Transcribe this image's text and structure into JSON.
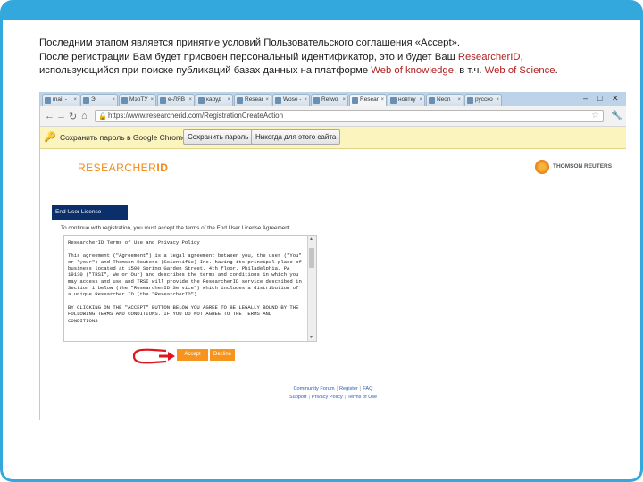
{
  "caption": {
    "line1": "Последним этапом является принятие условий Пользовательского соглашения «Accept».",
    "line2": "После регистрации Вам будет присвоен персональный идентификатор, это и будет Ваш",
    "line2_hl": "ResearcherID,",
    "line3": "использующийся при поиске публикаций базах данных на платформе",
    "line3_hl1": "Web of knowledge",
    "line3_mid": ", в т.ч.",
    "line3_hl2": "Web of Science",
    "line3_end": "."
  },
  "browser": {
    "tabs": [
      "mail -",
      "Э",
      "МэрТУ",
      "e-ЛЯВ",
      "каруд",
      "Resear",
      "Wose -",
      "Refwo",
      "Resear",
      "новтку",
      "Neon",
      "русско"
    ],
    "url": "https://www.researcherid.com/RegistrationCreateAction",
    "infobar": {
      "message": "Сохранить пароль в Google Chrome?",
      "save": "Сохранить пароль",
      "never": "Никогда для этого сайта"
    }
  },
  "page": {
    "logo_regular": "RESEARCHER",
    "logo_bold": "ID",
    "partner_logo": "THOMSON REUTERS",
    "eula_tab": "End User License",
    "intro": "To continue with registration, you must accept the terms of the End User License Agreement.",
    "terms_title": "ResearcherID Terms of Use and Privacy Policy",
    "terms_p1": "This agreement (\"Agreement\") is a legal agreement between you, the user (\"You\" or \"your\") and Thomson Reuters (Scientific) Inc. having its principal place of business located at 1500 Spring Garden Street, 4th floor, Philadelphia, PA 19130 (\"TRSI\", We or Our) and describes the terms and conditions in which you may access and use and TRSI will provide the ResearcherID service described in Section 1 below (the \"ResearcherID Service\") which includes a distribution of a unique Researcher ID (the \"ResearcherID\").",
    "terms_p2": "BY CLICKING ON THE \"ACCEPT\" BUTTON BELOW YOU AGREE TO BE LEGALLY BOUND BY THE FOLLOWING TERMS AND CONDITIONS. IF YOU DO NOT AGREE TO THE TERMS AND CONDITIONS",
    "accept": "Accept",
    "decline": "Decline",
    "footer_row1": [
      "Community Forum",
      "Register",
      "FAQ"
    ],
    "footer_row2": [
      "Support",
      "Privacy Policy",
      "Terms of Use"
    ]
  },
  "colors": {
    "frame": "#33a8dc",
    "highlight": "#b01e1e",
    "brand_orange": "#f7941d",
    "eula_navy": "#0b2f6b",
    "arrow_red": "#e0141c"
  }
}
